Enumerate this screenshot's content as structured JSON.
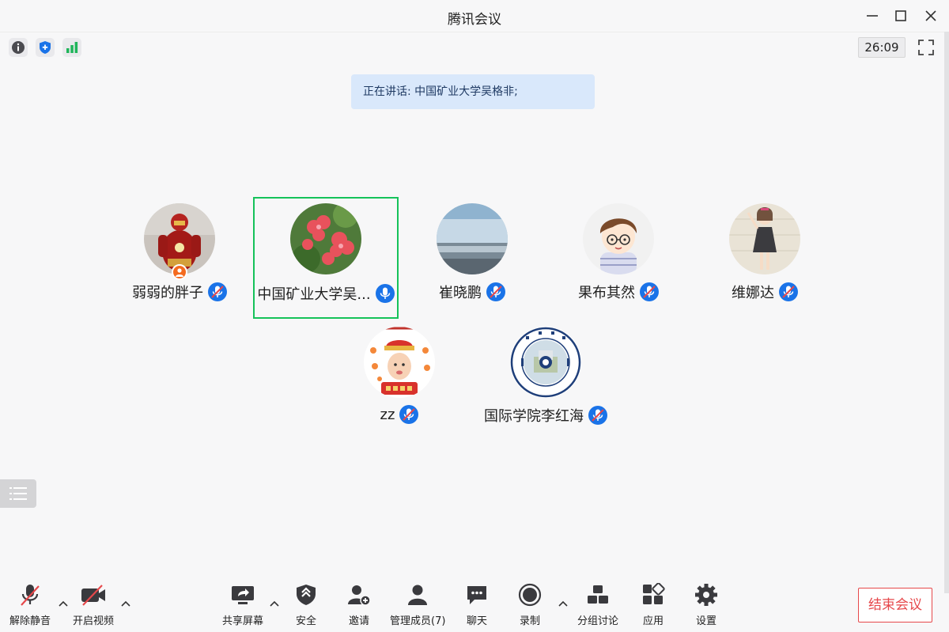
{
  "window": {
    "title": "腾讯会议"
  },
  "infobar": {
    "timer": "26:09"
  },
  "speaking": {
    "text": "正在讲话: 中国矿业大学吴格非;"
  },
  "participants": [
    {
      "name": "弱弱的胖子",
      "avatar": "ironman-avatar",
      "host": true,
      "mic": "muted"
    },
    {
      "name": "中国矿业大学吴...",
      "avatar": "flower-avatar",
      "host": false,
      "mic": "active",
      "speaking": true
    },
    {
      "name": "崔晓鹏",
      "avatar": "sea-avatar",
      "host": false,
      "mic": "muted"
    },
    {
      "name": "果布其然",
      "avatar": "cartoon-boy-avatar",
      "host": false,
      "mic": "muted"
    },
    {
      "name": "维娜达",
      "avatar": "cartoon-girl-avatar",
      "host": false,
      "mic": "muted"
    },
    {
      "name": "zz",
      "avatar": "baby-avatar",
      "host": false,
      "mic": "muted"
    },
    {
      "name": "国际学院李红海",
      "avatar": "cumt-logo-avatar",
      "host": false,
      "mic": "muted"
    }
  ],
  "toolbar": {
    "unmute": "解除静音",
    "video": "开启视频",
    "share": "共享屏幕",
    "security": "安全",
    "invite": "邀请",
    "members": "管理成员(7)",
    "chat": "聊天",
    "record": "录制",
    "breakout": "分组讨论",
    "apps": "应用",
    "settings": "设置",
    "end": "结束会议"
  },
  "colors": {
    "accent": "#1a73e8",
    "active_border": "#15c25a",
    "end": "#e6484b",
    "host_badge": "#f46a1e",
    "signal": "#1fb55a"
  }
}
